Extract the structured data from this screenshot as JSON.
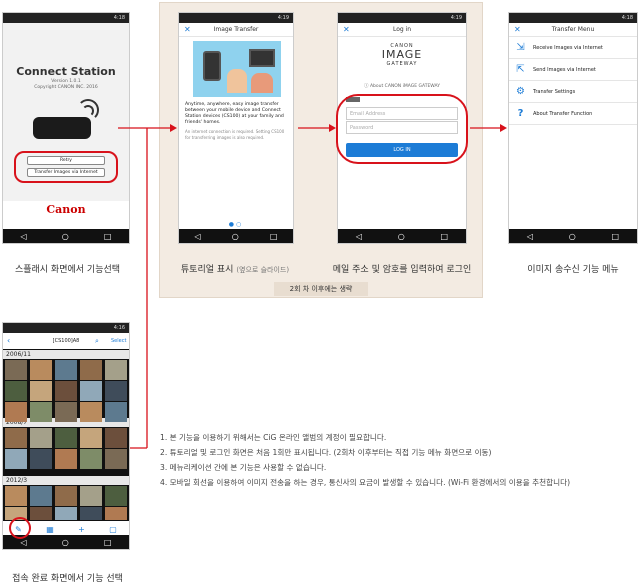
{
  "splash": {
    "status_time": "4:18",
    "app_title": "Connect Station",
    "version": "Version 1.0.1",
    "copyright": "Copyright CANON INC. 2016",
    "retry_label": "Retry",
    "transfer_label": "Transfer Images via Internet",
    "brand": "Canon",
    "caption": "스플래시 화면에서 기능선택"
  },
  "tutorial": {
    "status_time": "4:19",
    "title": "Image Transfer",
    "body": "Anytime, anywhere, easy image transfer between your mobile device and Connect Station devices (CS100) at your family and friends' homes.",
    "note": "An internet connection is required. Setting CS100 for transferring images is also required.",
    "caption_main": "튜토리얼 표시",
    "caption_sub": "(옆으로 슬라이드)"
  },
  "login": {
    "status_time": "4:19",
    "title": "Log in",
    "logo_canon": "CANON",
    "logo_image": "IMAGE",
    "logo_gateway": "GATEWAY",
    "about_link": "About CANON iMAGE GATEWAY",
    "email_placeholder": "Email Address",
    "password_placeholder": "Password",
    "login_label": "LOG IN",
    "caption": "메일 주소 및 암호를 입력하여 로그인"
  },
  "skip_note": "2회 차 이후에는 생략",
  "menu": {
    "status_time": "4:18",
    "title": "Transfer Menu",
    "items": [
      {
        "label": "Receive Images via Internet",
        "icon": "download-icon"
      },
      {
        "label": "Send Images via Internet",
        "icon": "upload-icon"
      },
      {
        "label": "Transfer Settings",
        "icon": "gear-icon"
      },
      {
        "label": "About Transfer Function",
        "icon": "question-icon"
      }
    ],
    "caption": "이미지 송수신 기능 메뉴"
  },
  "gallery": {
    "status_time": "4:16",
    "title": "[CS100]A8",
    "select_label": "Select",
    "sections": [
      "2006/11",
      "2008/7",
      "2012/3"
    ],
    "caption": "접속 완료 화면에서 기능 선택"
  },
  "notes": [
    "1. 본 기능을 이용하기 위해서는 CiG 온라인 앨범의 계정이 필요합니다.",
    "2. 튜토리얼 및 로그인 화면은 처음 1회만 표시됩니다. (2회차 이후부터는 직접 기능 메뉴 화면으로 이동)",
    "3. 메뉴리케이션 간에 본 기능은 사용할 수 없습니다.",
    "4. 모바일 회선을 이용하여 이미지 전송을 하는 경우, 통신사의 요금이 발생할 수 있습니다. (Wi-Fi 환경에서의 이용을 추천합니다)"
  ],
  "colors": {
    "accent": "#1d7cd6",
    "highlight": "#d8121b",
    "panel": "#f3ebe2",
    "brand": "#cc0000"
  }
}
